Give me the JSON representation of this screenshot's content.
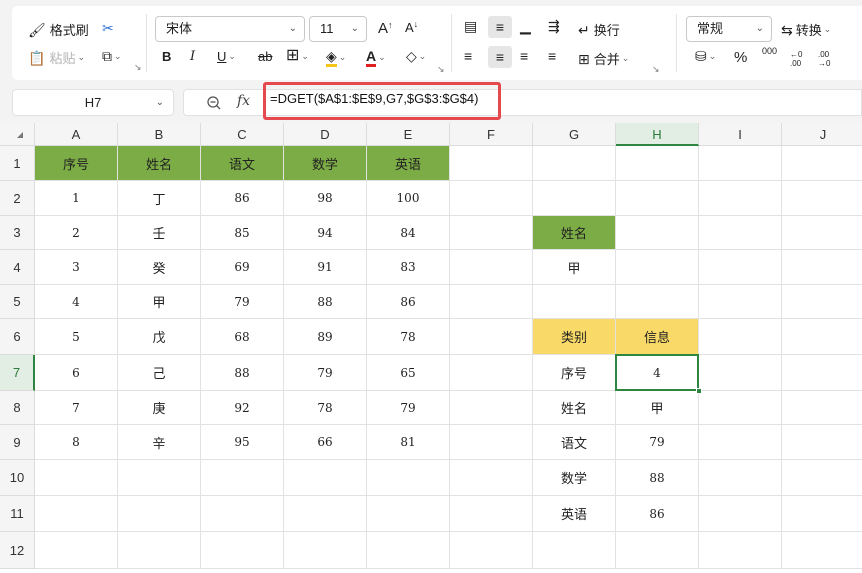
{
  "toolbar": {
    "format_painter": "格式刷",
    "paste": "粘贴",
    "font_name": "宋体",
    "font_size": "11",
    "bold": "B",
    "italic": "I",
    "underline": "U",
    "strike": "ab",
    "font_color_letter": "A",
    "wrap": "换行",
    "merge": "合并",
    "number_format": "常规",
    "convert": "转换",
    "percent": "%",
    "thousands": "000",
    "dec_inc": "←0 .00",
    "dec_dec": ".00 →0",
    "font_grow": "A",
    "font_shrink": "A",
    "colors": {
      "font_color": "#e02020",
      "fill_color": "#f5c518"
    }
  },
  "formula_bar": {
    "name_box": "H7",
    "fx": "fx",
    "formula": "=DGET($A$1:$E$9,G7,$G$3:$G$4)"
  },
  "sheet": {
    "columns": [
      "A",
      "B",
      "C",
      "D",
      "E",
      "F",
      "G",
      "H",
      "I",
      "J"
    ],
    "rows": [
      "1",
      "2",
      "3",
      "4",
      "5",
      "6",
      "7",
      "8",
      "9",
      "10",
      "11",
      "12"
    ],
    "active_cell": "H7",
    "table_header": [
      "序号",
      "姓名",
      "语文",
      "数学",
      "英语"
    ],
    "table_rows": [
      [
        "1",
        "丁",
        "86",
        "98",
        "100"
      ],
      [
        "2",
        "壬",
        "85",
        "94",
        "84"
      ],
      [
        "3",
        "癸",
        "69",
        "91",
        "83"
      ],
      [
        "4",
        "甲",
        "79",
        "88",
        "86"
      ],
      [
        "5",
        "戊",
        "68",
        "89",
        "78"
      ],
      [
        "6",
        "己",
        "88",
        "79",
        "65"
      ],
      [
        "7",
        "庚",
        "92",
        "78",
        "79"
      ],
      [
        "8",
        "辛",
        "95",
        "66",
        "81"
      ]
    ],
    "criteria_header": "姓名",
    "criteria_value": "甲",
    "result_header": [
      "类别",
      "信息"
    ],
    "result_rows": [
      [
        "序号",
        "4"
      ],
      [
        "姓名",
        "甲"
      ],
      [
        "语文",
        "79"
      ],
      [
        "数学",
        "88"
      ],
      [
        "英语",
        "86"
      ]
    ],
    "colors": {
      "header_green": "#7cac45",
      "header_yellow": "#f9d967",
      "selection": "#2e8540",
      "highlight_border": "#e5484d"
    }
  }
}
